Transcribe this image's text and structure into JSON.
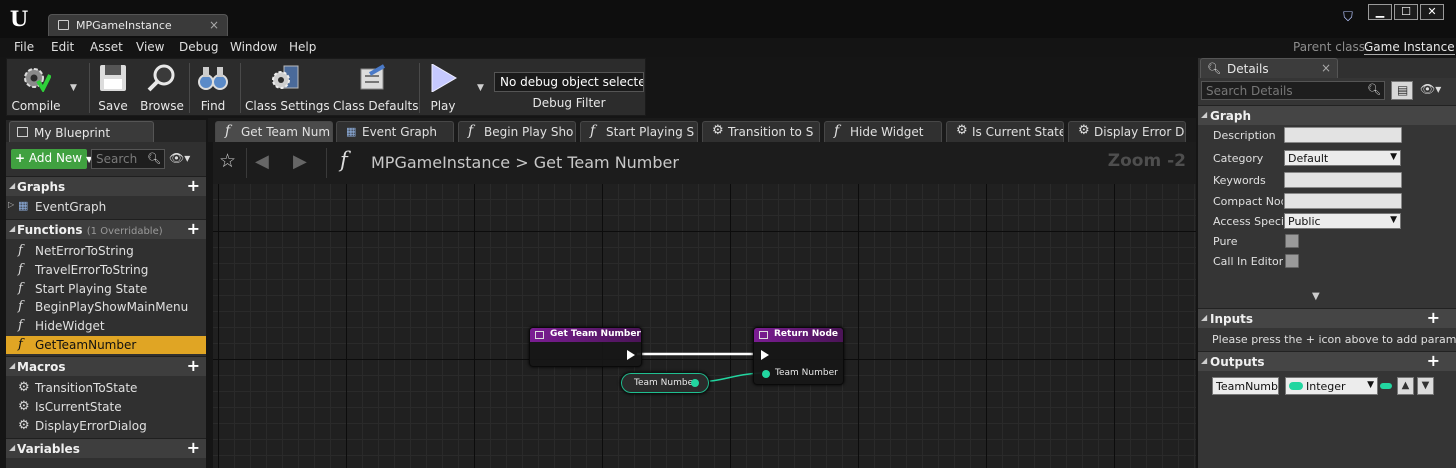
{
  "window": {
    "doc_tab_title": "MPGameInstance",
    "close_glyph": "×",
    "minimize_glyph": "▁",
    "maximize_glyph": "☐",
    "win_close_glyph": "✕"
  },
  "menu": {
    "items": [
      "File",
      "Edit",
      "Asset",
      "View",
      "Debug",
      "Window",
      "Help"
    ],
    "parent_class_label": "Parent class:",
    "parent_class_value": "Game Instance"
  },
  "toolbar": {
    "buttons": [
      "Compile",
      "Save",
      "Browse",
      "Find",
      "Class Settings",
      "Class Defaults",
      "Play"
    ],
    "debug_object": "No debug object selected",
    "debug_filter_label": "Debug Filter"
  },
  "my_blueprint": {
    "tab_title": "My Blueprint",
    "add_new": "Add New",
    "search_placeholder": "Search",
    "graphs_title": "Graphs",
    "graphs": [
      "EventGraph"
    ],
    "functions_title": "Functions",
    "functions_sub": "(1 Overridable)",
    "functions": [
      "NetErrorToString",
      "TravelErrorToString",
      "Start Playing State",
      "BeginPlayShowMainMenu",
      "HideWidget",
      "GetTeamNumber"
    ],
    "selected_function": "GetTeamNumber",
    "macros_title": "Macros",
    "macros": [
      "TransitionToState",
      "IsCurrentState",
      "DisplayErrorDialog"
    ],
    "variables_title": "Variables"
  },
  "graph_tabs": [
    "Get Team Num",
    "Event Graph",
    "Begin Play Sho",
    "Start Playing S",
    "Transition to S",
    "Hide Widget",
    "Is Current State",
    "Display Error D"
  ],
  "graph": {
    "breadcrumb": "MPGameInstance > Get Team Number",
    "zoom": "Zoom -2",
    "entry_node_title": "Get Team Number",
    "return_node_title": "Return Node",
    "variable_node_label": "Team Number",
    "return_pin_label": "Team Number",
    "pin_color": "#22d6a0",
    "function_header_color": "#7b1d93"
  },
  "details": {
    "tab_title": "Details",
    "search_placeholder": "Search Details",
    "graph_title": "Graph",
    "props": {
      "description": "Description",
      "category": "Category",
      "category_value": "Default",
      "keywords": "Keywords",
      "compact_node": "Compact Node",
      "access": "Access Specif",
      "access_value": "Public",
      "pure": "Pure",
      "call_in_editor": "Call In Editor"
    },
    "inputs_title": "Inputs",
    "inputs_message": "Please press the + icon above to add parameter",
    "outputs_title": "Outputs",
    "output_name": "TeamNumbe",
    "output_type": "Integer"
  },
  "colors": {
    "selected_item": "#e0a524",
    "add_new": "#40a140",
    "integer_pin": "#22d6a0"
  }
}
